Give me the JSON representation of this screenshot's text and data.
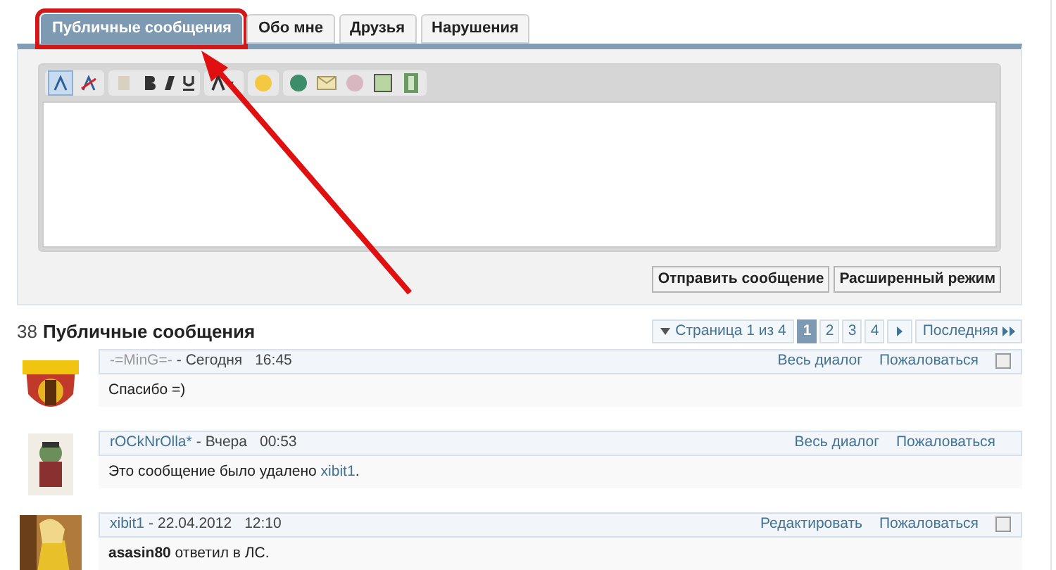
{
  "tabs": [
    {
      "label": "Публичные сообщения",
      "selected": true,
      "highlighted": true
    },
    {
      "label": "Обо мне",
      "selected": false,
      "highlighted": false
    },
    {
      "label": "Друзья",
      "selected": false,
      "highlighted": false
    },
    {
      "label": "Нарушения",
      "selected": false,
      "highlighted": false
    }
  ],
  "editor": {
    "buttons": [
      {
        "label": "Отправить сообщение"
      },
      {
        "label": "Расширенный режим"
      }
    ]
  },
  "heading": {
    "count": "38",
    "title": "Публичные сообщения"
  },
  "pagination": {
    "label": "Страница 1 из 4",
    "pages": [
      {
        "label": "1",
        "selected": true
      },
      {
        "label": "2",
        "selected": false
      },
      {
        "label": "3",
        "selected": false
      },
      {
        "label": "4",
        "selected": false
      }
    ],
    "last": "Последняя"
  },
  "messages": [
    {
      "author": "-=MinG=-",
      "muted": true,
      "separator": "-",
      "date": "Сегодня",
      "time": "16:45",
      "body": [
        {
          "kind": "text",
          "text": "Спасибо =)"
        }
      ],
      "actions": [
        "Весь диалог",
        "Пожаловаться"
      ],
      "checked": false
    },
    {
      "author": "rOCkNrOlla*",
      "muted": false,
      "separator": "-",
      "date": "Вчера",
      "time": "00:53",
      "body": [
        {
          "kind": "text",
          "text": "Это сообщение было удалено "
        },
        {
          "kind": "link",
          "text": "xibit1"
        },
        {
          "kind": "text",
          "text": "."
        }
      ],
      "actions": [
        "Весь диалог",
        "Пожаловаться"
      ]
    },
    {
      "author": "xibit1",
      "muted": false,
      "separator": "-",
      "date": "22.04.2012",
      "time": "12:10",
      "body": [
        {
          "kind": "bold",
          "text": "asasin80"
        },
        {
          "kind": "text",
          "text": " ответил в ЛС."
        }
      ],
      "actions": [
        "Редактировать",
        "Пожаловаться"
      ],
      "checked": false
    }
  ]
}
